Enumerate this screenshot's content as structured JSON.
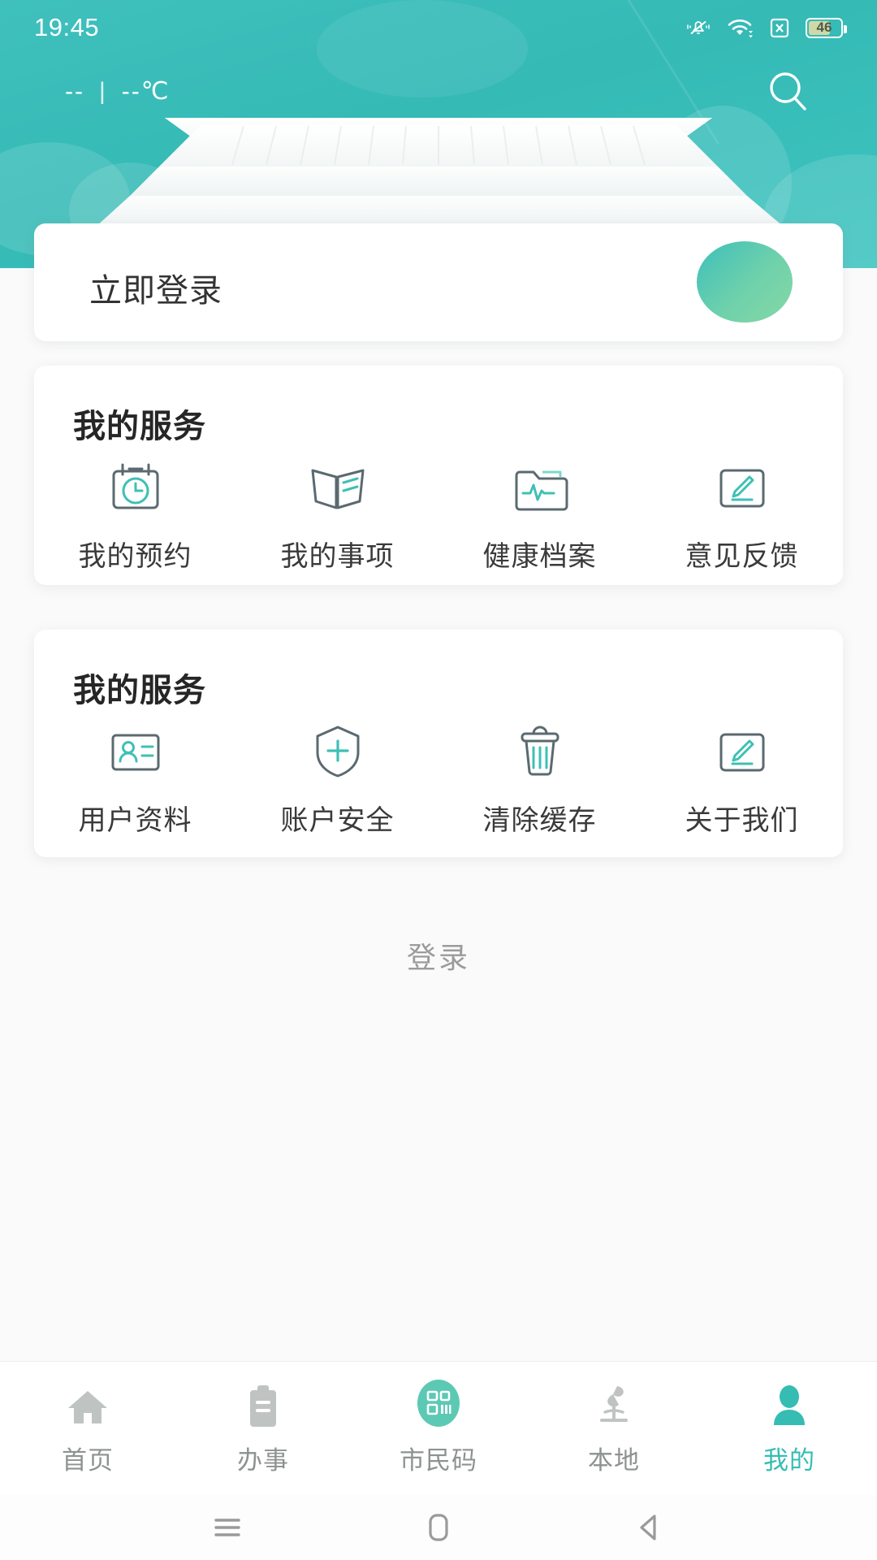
{
  "status_bar": {
    "time": "19:45",
    "battery_level": "46",
    "icons": [
      "mute-icon",
      "wifi-icon",
      "sim-error-icon",
      "battery-icon"
    ]
  },
  "header": {
    "weather_temp": "--",
    "weather_sep": "|",
    "weather_unit": "--℃",
    "search_icon": "search-icon",
    "background_color": "#35bab6"
  },
  "login_card": {
    "title": "立即登录",
    "avatar_icon": "avatar"
  },
  "sections": [
    {
      "title": "我的服务",
      "items": [
        {
          "label": "我的预约",
          "icon": "calendar-clock-icon"
        },
        {
          "label": "我的事项",
          "icon": "open-book-icon"
        },
        {
          "label": "健康档案",
          "icon": "folder-pulse-icon"
        },
        {
          "label": "意见反馈",
          "icon": "edit-pencil-icon"
        }
      ]
    },
    {
      "title": "我的服务",
      "items": [
        {
          "label": "用户资料",
          "icon": "id-card-icon"
        },
        {
          "label": "账户安全",
          "icon": "shield-plus-icon"
        },
        {
          "label": "清除缓存",
          "icon": "trash-icon"
        },
        {
          "label": "关于我们",
          "icon": "edit-pencil-icon"
        }
      ]
    }
  ],
  "login_link": {
    "label": "登录"
  },
  "tabbar": {
    "active_color": "#35bdb4",
    "inactive_color": "#8e9291",
    "tabs": [
      {
        "label": "首页",
        "icon": "home-icon",
        "active": false
      },
      {
        "label": "办事",
        "icon": "clipboard-icon",
        "active": false
      },
      {
        "label": "市民码",
        "icon": "qr-code-icon",
        "active": false
      },
      {
        "label": "本地",
        "icon": "landmark-icon",
        "active": false
      },
      {
        "label": "我的",
        "icon": "person-icon",
        "active": true
      }
    ]
  },
  "android_nav": {
    "buttons": [
      {
        "icon": "recents-menu-icon"
      },
      {
        "icon": "home-square-icon"
      },
      {
        "icon": "back-triangle-icon"
      }
    ]
  }
}
